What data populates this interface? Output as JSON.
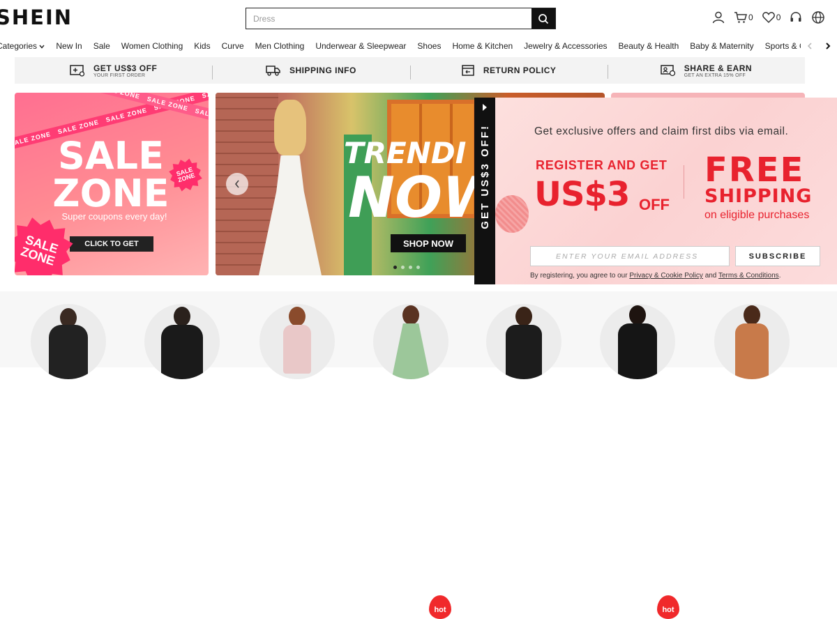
{
  "header": {
    "logo": "SHEIN",
    "search_placeholder": "Dress",
    "cart_count": "0",
    "wishlist_count": "0"
  },
  "nav": {
    "items": [
      "Categories",
      "New In",
      "Sale",
      "Women Clothing",
      "Kids",
      "Curve",
      "Men Clothing",
      "Underwear & Sleepwear",
      "Shoes",
      "Home & Kitchen",
      "Jewelry & Accessories",
      "Beauty & Health",
      "Baby & Maternity",
      "Sports & Outdoo"
    ]
  },
  "benefits": [
    {
      "title": "GET US$3 OFF",
      "subtitle": "YOUR FIRST ORDER"
    },
    {
      "title": "SHIPPING INFO",
      "subtitle": ""
    },
    {
      "title": "RETURN POLICY",
      "subtitle": ""
    },
    {
      "title": "SHARE & EARN",
      "subtitle": "GET AN EXTRA 15% OFF"
    }
  ],
  "banner_sale": {
    "tape_text": "SALE ZONE",
    "title_line1": "SALE",
    "title_line2": "ZONE",
    "subtitle": "Super coupons every day!",
    "cta": "CLICK TO GET",
    "badge_line1": "SALE",
    "badge_line2": "ZONE"
  },
  "banner_trending": {
    "line1": "TRENDI",
    "line2": "NOW",
    "cta": "SHOP NOW"
  },
  "popup": {
    "tab_text": "GET US$3 OFF!",
    "headline": "Get exclusive offers and claim first dibs via email.",
    "register": "REGISTER AND GET",
    "amount": "US$3",
    "amount_suffix": "OFF",
    "free": "FREE",
    "shipping": "SHIPPING",
    "eligible": "on eligible purchases",
    "email_placeholder": "ENTER YOUR EMAIL ADDRESS",
    "subscribe": "SUBSCRIBE",
    "terms_prefix": "By registering, you agree to our",
    "privacy_link": "Privacy & Cookie Policy",
    "and": "and",
    "terms_link": "Terms & Conditions",
    "terms_suffix": "."
  },
  "categories": {
    "hot_label": "hot"
  }
}
